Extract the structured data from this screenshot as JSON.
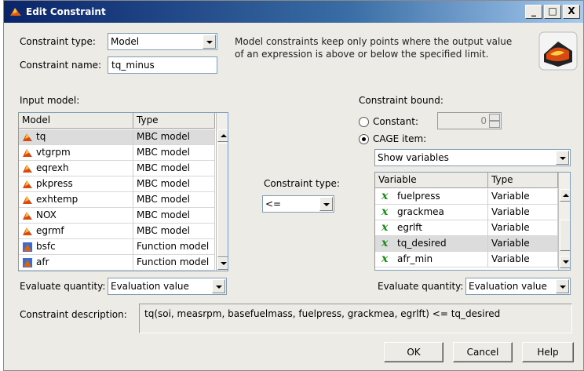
{
  "window": {
    "title": "Edit Constraint",
    "controls": {
      "minimize": "_",
      "maximize": "□",
      "close": "X"
    }
  },
  "top": {
    "constraint_type_label": "Constraint type:",
    "constraint_type_value": "Model",
    "constraint_name_label": "Constraint name:",
    "constraint_name_value": "tq_minus",
    "description": "Model constraints keep only points where the output value of an expression is above or below the specified limit."
  },
  "input_model": {
    "label": "Input model:",
    "columns": [
      "Model",
      "Type"
    ],
    "rows": [
      {
        "name": "tq",
        "type": "MBC model",
        "icon": "mbc-model-icon"
      },
      {
        "name": "vtgrpm",
        "type": "MBC model",
        "icon": "mbc-model-icon"
      },
      {
        "name": "eqrexh",
        "type": "MBC model",
        "icon": "mbc-model-icon"
      },
      {
        "name": "pkpress",
        "type": "MBC model",
        "icon": "mbc-model-icon"
      },
      {
        "name": "exhtemp",
        "type": "MBC model",
        "icon": "mbc-model-icon"
      },
      {
        "name": "NOX",
        "type": "MBC model",
        "icon": "mbc-model-icon"
      },
      {
        "name": "egrmf",
        "type": "MBC model",
        "icon": "mbc-model-icon"
      },
      {
        "name": "bsfc",
        "type": "Function model",
        "icon": "function-model-icon"
      },
      {
        "name": "afr",
        "type": "Function model",
        "icon": "function-model-icon"
      }
    ],
    "selected_index": 0,
    "evaluate_label": "Evaluate quantity:",
    "evaluate_value": "Evaluation value"
  },
  "middle": {
    "constraint_type_label": "Constraint type:",
    "operator_value": "<="
  },
  "bound": {
    "label": "Constraint bound:",
    "constant_label": "Constant:",
    "constant_value": "0",
    "cage_label": "CAGE item:",
    "selected_option": "cage",
    "show_value": "Show variables",
    "columns": [
      "Variable",
      "Type"
    ],
    "rows": [
      {
        "name": "fuelpress",
        "type": "Variable"
      },
      {
        "name": "grackmea",
        "type": "Variable"
      },
      {
        "name": "egrlft",
        "type": "Variable"
      },
      {
        "name": "tq_desired",
        "type": "Variable"
      },
      {
        "name": "afr_min",
        "type": "Variable"
      }
    ],
    "selected_index": 3,
    "evaluate_label": "Evaluate quantity:",
    "evaluate_value": "Evaluation value"
  },
  "description": {
    "label": "Constraint description:",
    "text": "tq(soi, measrpm, basefuelmass, fuelpress, grackmea, egrlft) <= tq_desired"
  },
  "buttons": {
    "ok": "OK",
    "cancel": "Cancel",
    "help": "Help"
  },
  "colors": {
    "title_start": "#0a246a",
    "title_end": "#a6caf0",
    "dialog_bg": "#ecebe6",
    "variable_x": "#1a8a1a"
  }
}
